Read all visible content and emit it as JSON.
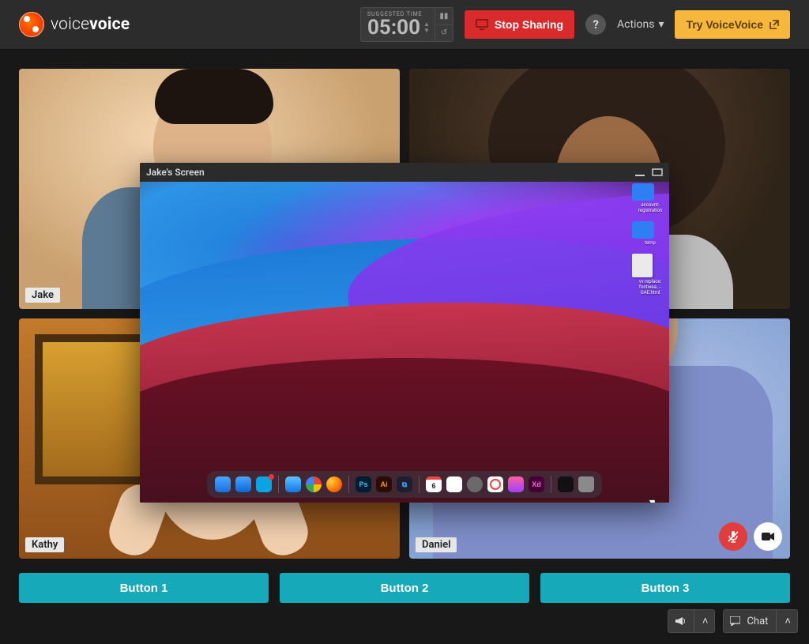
{
  "brand": {
    "name_light": "voice",
    "name_bold": "voice"
  },
  "header": {
    "timer": {
      "label": "SUGGESTED TIME",
      "value": "05:00",
      "pause_icon": "pause-icon",
      "reset_icon": "undo-icon"
    },
    "stop_label": "Stop Sharing",
    "help_text": "?",
    "actions_label": "Actions",
    "try_label": "Try VoiceVoice"
  },
  "participants": [
    {
      "name": "Jake"
    },
    {
      "name": ""
    },
    {
      "name": "Kathy"
    },
    {
      "name": "Daniel",
      "mic_muted": true,
      "cam_on": true
    }
  ],
  "buttons": [
    {
      "label": "Button 1"
    },
    {
      "label": "Button 2"
    },
    {
      "label": "Button 3"
    }
  ],
  "bottombar": {
    "chat_label": "Chat"
  },
  "screenshare": {
    "title": "Jake's Screen",
    "desktop_items": [
      {
        "kind": "folder",
        "label": "account-registration"
      },
      {
        "kind": "folder",
        "label": "temp"
      },
      {
        "kind": "file",
        "label": "vv replace: footwea...-GAE.html"
      }
    ],
    "dock_apps": [
      "finder",
      "mail",
      "skype",
      "safari",
      "chrome",
      "firefox",
      "photoshop",
      "illustrator",
      "vscode",
      "calendar",
      "notes",
      "settings",
      "todoist",
      "figma",
      "xd",
      "terminal",
      "trash"
    ]
  }
}
